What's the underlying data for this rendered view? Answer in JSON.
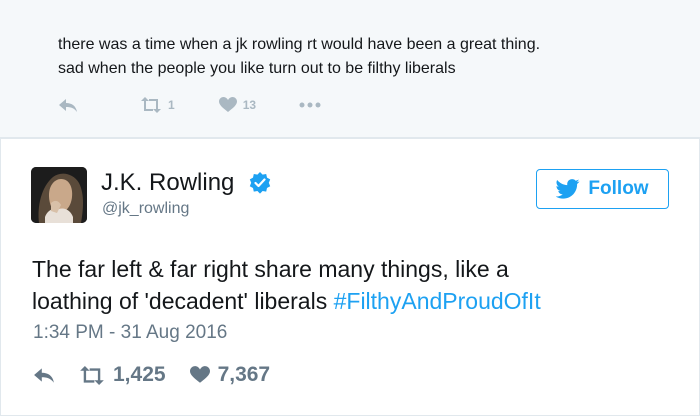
{
  "reply": {
    "line1": "there was a time when a jk rowling rt would have been a great thing.",
    "line2": "sad when the people you like turn out to be filthy liberals",
    "retweets": "1",
    "likes": "13"
  },
  "tweet": {
    "name": "J.K. Rowling",
    "handle": "@jk_rowling",
    "follow_label": "Follow",
    "text_line1": "The far left & far right share many things, like a",
    "text_line2": "loathing of 'decadent' liberals ",
    "hashtag": "#FilthyAndProudOfIt",
    "timestamp": "1:34 PM - 31 Aug 2016",
    "retweets": "1,425",
    "likes": "7,367"
  },
  "colors": {
    "accent": "#1da1f2",
    "muted": "#657786",
    "reply_bg": "#f5f8fa",
    "light_icon": "#aab8c2"
  },
  "icons": [
    "reply-icon",
    "retweet-icon",
    "heart-icon",
    "more-icon",
    "verified-icon",
    "twitter-bird-icon"
  ]
}
